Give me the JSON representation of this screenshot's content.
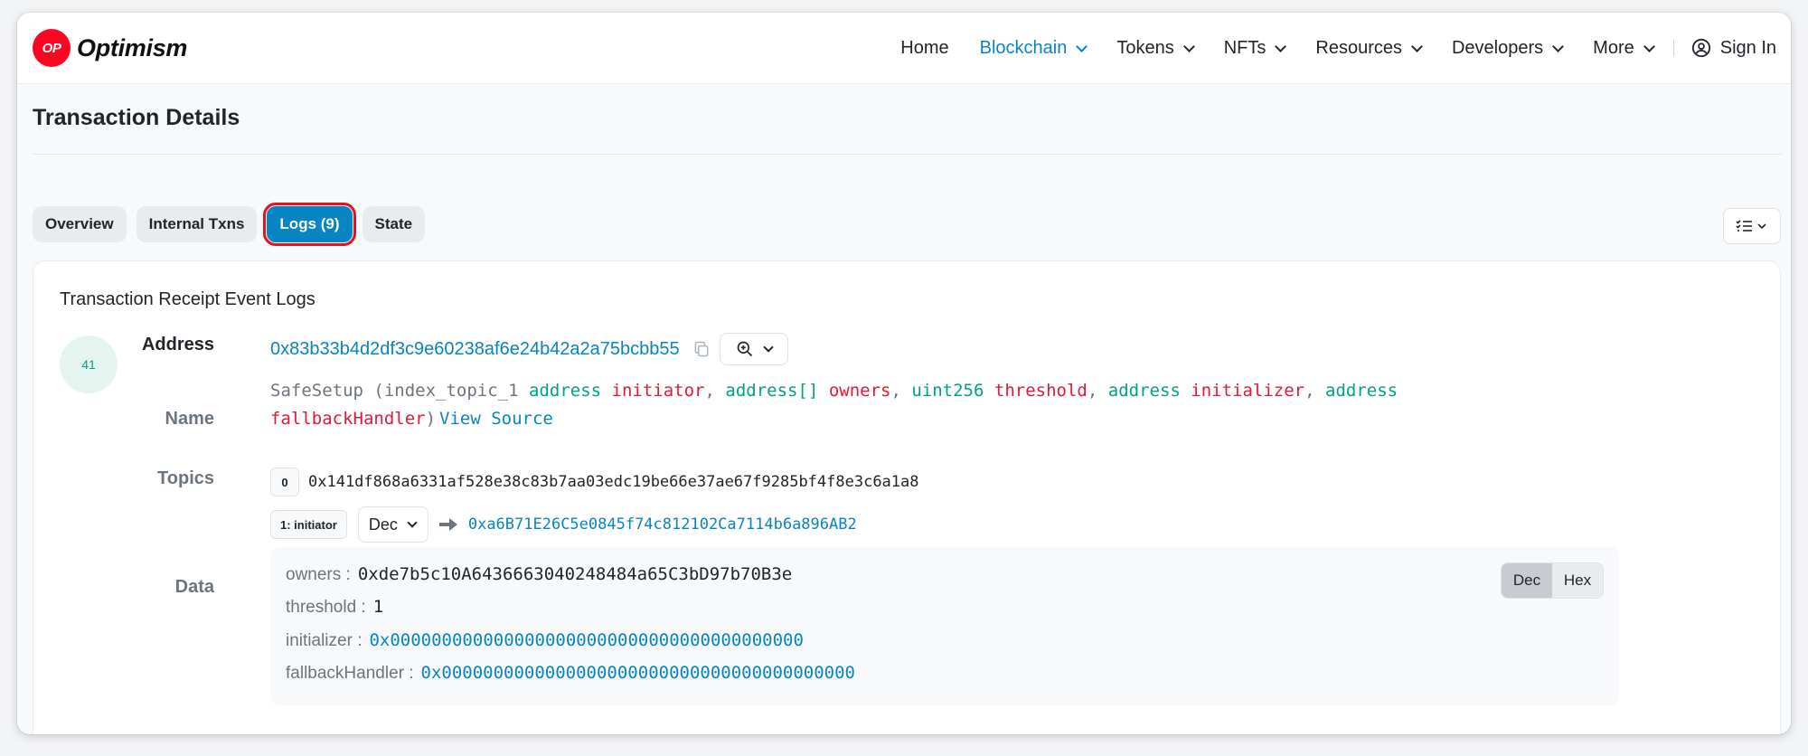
{
  "brand": {
    "badge": "OP",
    "name": "Optimism",
    "color": "#ff0420"
  },
  "nav": {
    "items": [
      {
        "label": "Home",
        "dropdown": false,
        "active": false
      },
      {
        "label": "Blockchain",
        "dropdown": true,
        "active": true
      },
      {
        "label": "Tokens",
        "dropdown": true,
        "active": false
      },
      {
        "label": "NFTs",
        "dropdown": true,
        "active": false
      },
      {
        "label": "Resources",
        "dropdown": true,
        "active": false
      },
      {
        "label": "Developers",
        "dropdown": true,
        "active": false
      },
      {
        "label": "More",
        "dropdown": true,
        "active": false
      }
    ],
    "sign_in": "Sign In"
  },
  "page": {
    "title": "Transaction Details"
  },
  "tabs": [
    {
      "label": "Overview",
      "active": false
    },
    {
      "label": "Internal Txns",
      "active": false
    },
    {
      "label": "Logs (9)",
      "active": true
    },
    {
      "label": "State",
      "active": false
    }
  ],
  "logs": {
    "card_title": "Transaction Receipt Event Logs",
    "entry": {
      "index": "41",
      "labels": {
        "address": "Address",
        "name": "Name",
        "topics": "Topics",
        "data": "Data"
      },
      "address": "0x83b33b4d2df3c9e60238af6e24b42a2a75bcbb55",
      "signature": {
        "fn": "SafeSetup",
        "open": " (",
        "index_topic": "index_topic_1",
        "params": [
          {
            "type": "address",
            "name": "initiator"
          },
          {
            "type": "address[]",
            "name": "owners"
          },
          {
            "type": "uint256",
            "name": "threshold"
          },
          {
            "type": "address",
            "name": "initializer"
          },
          {
            "type": "address",
            "name": "fallbackHandler"
          }
        ],
        "close": ")",
        "view_source": "View Source"
      },
      "topics": [
        {
          "badge": "0",
          "value": "0x141df868a6331af528e38c83b7aa03edc19be66e37ae67f9285bf4f8e3c6a1a8"
        },
        {
          "badge": "1: initiator",
          "format": "Dec",
          "value": "0xa6B71E26C5e0845f74c812102Ca7114b6a896AB2"
        }
      ],
      "data": [
        {
          "key": "owners :",
          "value": "0xde7b5c10A6436663040248484a65C3bD97b70B3e",
          "link": false
        },
        {
          "key": "threshold :",
          "value": "1",
          "link": false
        },
        {
          "key": "initializer :",
          "value": "0x0000000000000000000000000000000000000000",
          "link": true
        },
        {
          "key": "fallbackHandler :",
          "value": "0x0000000000000000000000000000000000000000",
          "link": true
        }
      ],
      "data_formats": [
        {
          "label": "Dec",
          "active": true
        },
        {
          "label": "Hex",
          "active": false
        }
      ]
    }
  },
  "colors": {
    "accent": "#0784c3",
    "type": "#00a186",
    "param": "#de1b36",
    "highlight": "#e8101b"
  }
}
